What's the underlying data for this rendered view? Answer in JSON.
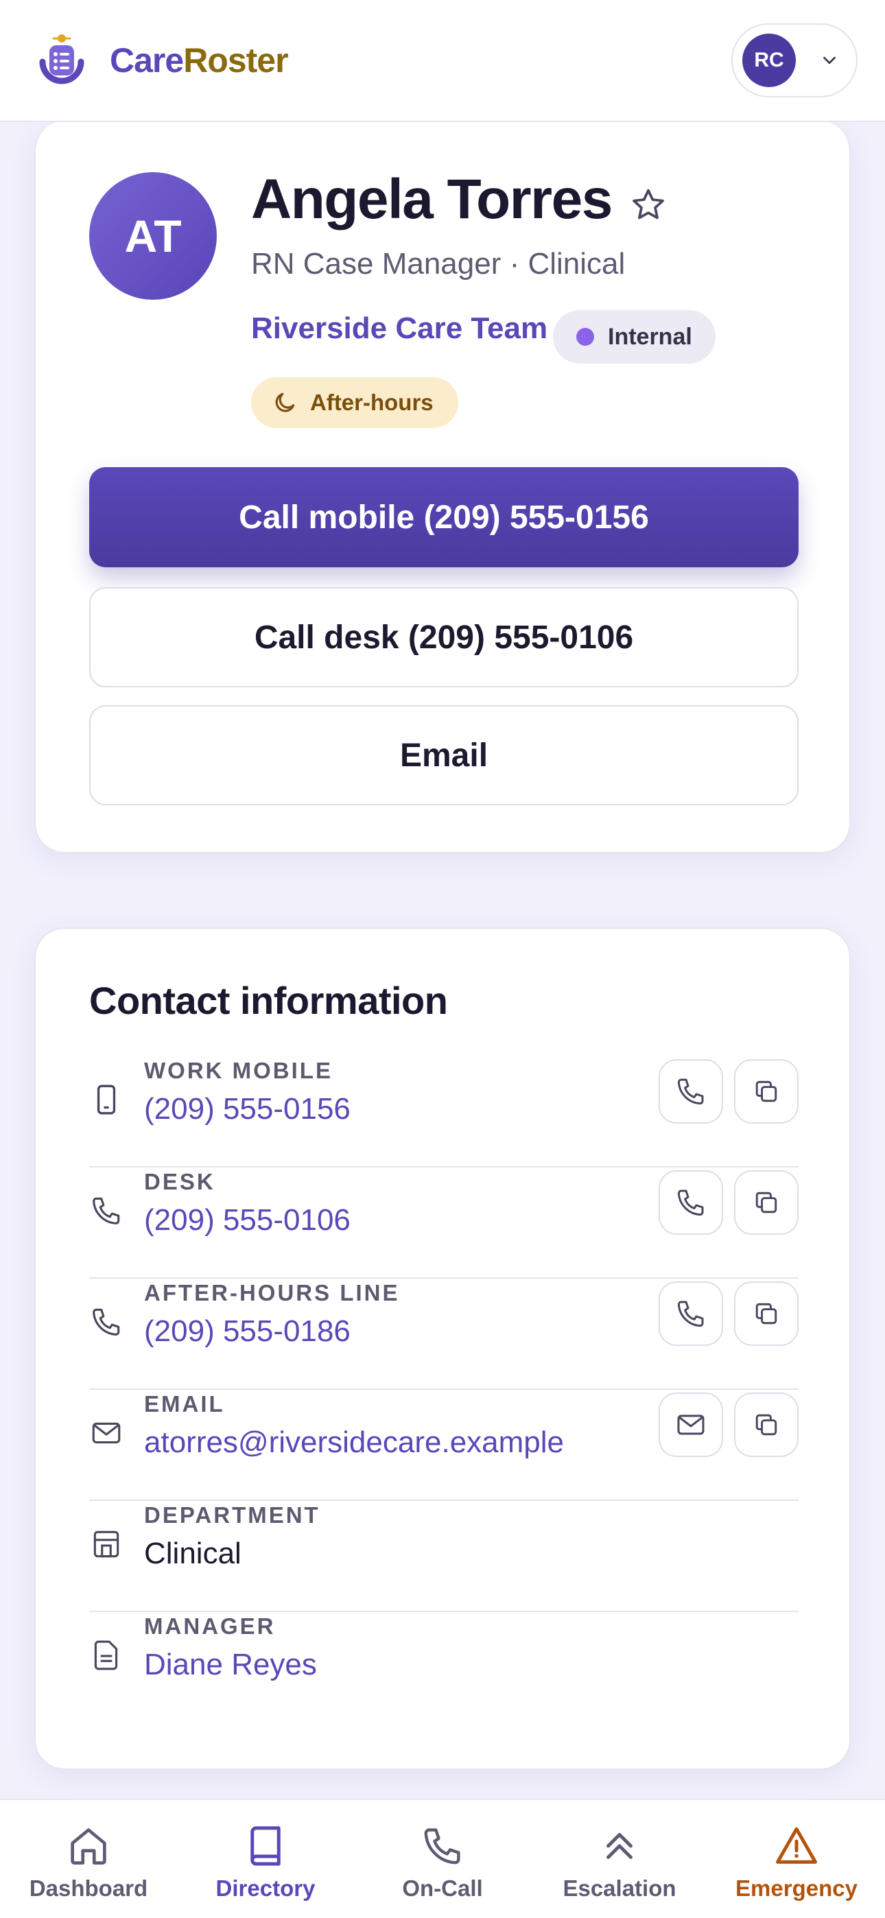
{
  "app": {
    "brand_part1": "Care",
    "brand_part2": "Roster",
    "account_initials": "RC"
  },
  "profile": {
    "initials": "AT",
    "name": "Angela Torres",
    "role": "RN Case Manager · Clinical",
    "team": "Riverside Care Team",
    "badge_internal": "Internal",
    "badge_afterhours": "After-hours",
    "call_mobile_label": "Call mobile (209) 555-0156",
    "call_desk_label": "Call desk (209) 555-0106",
    "email_label": "Email"
  },
  "contact": {
    "title": "Contact information",
    "rows": [
      {
        "label": "WORK MOBILE",
        "value": "(209) 555-0156",
        "icon": "mobile-icon"
      },
      {
        "label": "DESK",
        "value": "(209) 555-0106",
        "icon": "phone-icon"
      },
      {
        "label": "AFTER-HOURS LINE",
        "value": "(209) 555-0186",
        "icon": "phone-icon"
      },
      {
        "label": "EMAIL",
        "value": "atorres@riversidecare.example",
        "icon": "mail-icon"
      },
      {
        "label": "DEPARTMENT",
        "value": "Clinical",
        "icon": "building-icon"
      },
      {
        "label": "MANAGER",
        "value": "Diane Reyes",
        "icon": "document-icon"
      }
    ]
  },
  "nav": {
    "items": [
      {
        "label": "Dashboard",
        "icon": "home-icon"
      },
      {
        "label": "Directory",
        "icon": "book-icon"
      },
      {
        "label": "On-Call",
        "icon": "phone-icon"
      },
      {
        "label": "Escalation",
        "icon": "chevrons-up-icon"
      },
      {
        "label": "Emergency",
        "icon": "warning-icon"
      }
    ],
    "active": "Directory"
  },
  "colors": {
    "accent": "#5b47b8",
    "brand_gold": "#8a6a0e",
    "emergency": "#b5530b",
    "afterhours_bg": "#fbeccc"
  }
}
